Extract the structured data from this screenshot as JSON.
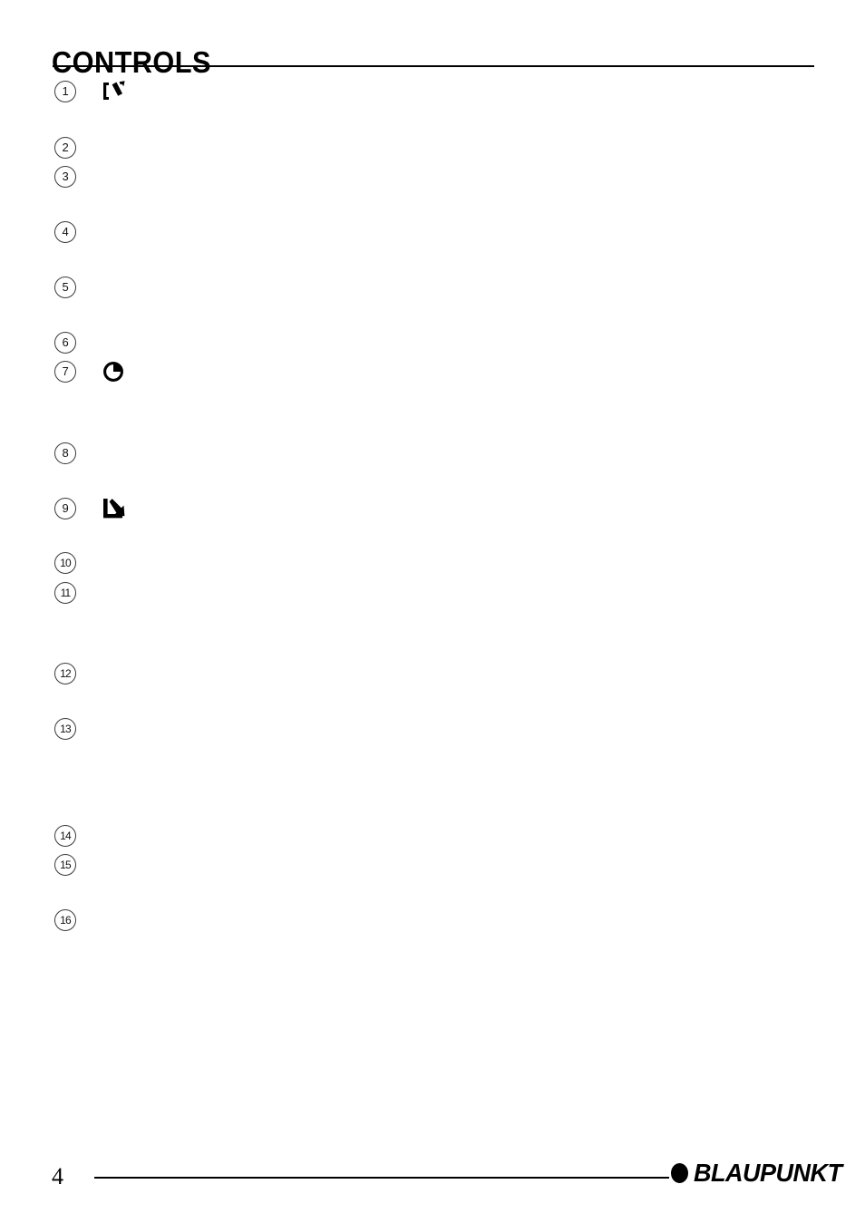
{
  "document": {
    "title": "CONTROLS",
    "page_number": "4"
  },
  "brand": {
    "name": "BLAUPUNKT",
    "mark": "filled-circle-icon",
    "color": "#000000"
  },
  "callouts": [
    {
      "number": "1",
      "icon": "release-panel-icon",
      "text": ""
    },
    {
      "number": "2",
      "icon": null,
      "text": ""
    },
    {
      "number": "3",
      "icon": null,
      "text": ""
    },
    {
      "number": "4",
      "icon": null,
      "text": ""
    },
    {
      "number": "5",
      "icon": null,
      "text": ""
    },
    {
      "number": "6",
      "icon": null,
      "text": ""
    },
    {
      "number": "7",
      "icon": "clock-icon",
      "text": ""
    },
    {
      "number": "8",
      "icon": null,
      "text": ""
    },
    {
      "number": "9",
      "icon": "arrow-down-right-icon",
      "text": ""
    },
    {
      "number": "10",
      "icon": null,
      "text": ""
    },
    {
      "number": "11",
      "icon": null,
      "text": ""
    },
    {
      "number": "12",
      "icon": null,
      "text": ""
    },
    {
      "number": "13",
      "icon": null,
      "text": ""
    },
    {
      "number": "14",
      "icon": null,
      "text": ""
    },
    {
      "number": "15",
      "icon": null,
      "text": ""
    },
    {
      "number": "16",
      "icon": null,
      "text": ""
    }
  ],
  "layout": {
    "callout_tops": [
      89,
      151,
      183,
      244,
      305,
      366,
      398,
      488,
      549,
      609,
      642,
      731,
      792,
      910,
      942,
      1003
    ]
  }
}
